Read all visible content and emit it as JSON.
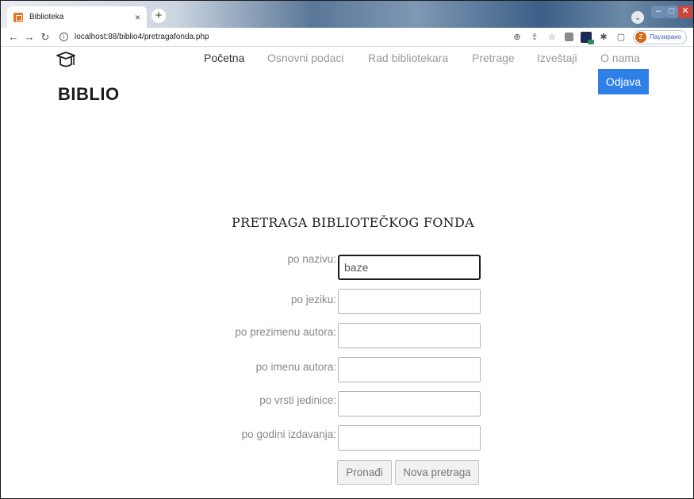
{
  "browser": {
    "tab_title": "Biblioteka",
    "tab_close": "×",
    "new_tab": "+",
    "url": "localhost:88/biblio4/pretragafonda.php",
    "profile_initial": "Z",
    "profile_label": "Паузирано",
    "window_controls": {
      "minimize": "–",
      "maximize": "□",
      "close": "✕"
    }
  },
  "header": {
    "brand": "BIBLIO",
    "logo_icon": "graduation-cap-icon",
    "menu": [
      {
        "label": "Početna",
        "active": true
      },
      {
        "label": "Osnovni podaci",
        "active": false
      },
      {
        "label": "Rad bibliotekara",
        "active": false
      },
      {
        "label": "Pretrage",
        "active": false
      },
      {
        "label": "Izveštaji",
        "active": false
      },
      {
        "label": "O nama",
        "active": false
      }
    ],
    "logout_label": "Odjava"
  },
  "form": {
    "title": "PRETRAGA BIBLIOTEČKOG FONDA",
    "fields": [
      {
        "label": "po nazivu:",
        "value": "baze"
      },
      {
        "label": "po jeziku:",
        "value": ""
      },
      {
        "label": "po prezimenu autora:",
        "value": ""
      },
      {
        "label": "po imenu autora:",
        "value": ""
      },
      {
        "label": "po vrsti jedinice:",
        "value": ""
      },
      {
        "label": "po godini izdavanja:",
        "value": ""
      }
    ],
    "search_label": "Pronađi",
    "reset_label": "Nova pretraga"
  },
  "colors": {
    "accent": "#2f7fe8",
    "favicon": "#e8711f"
  }
}
